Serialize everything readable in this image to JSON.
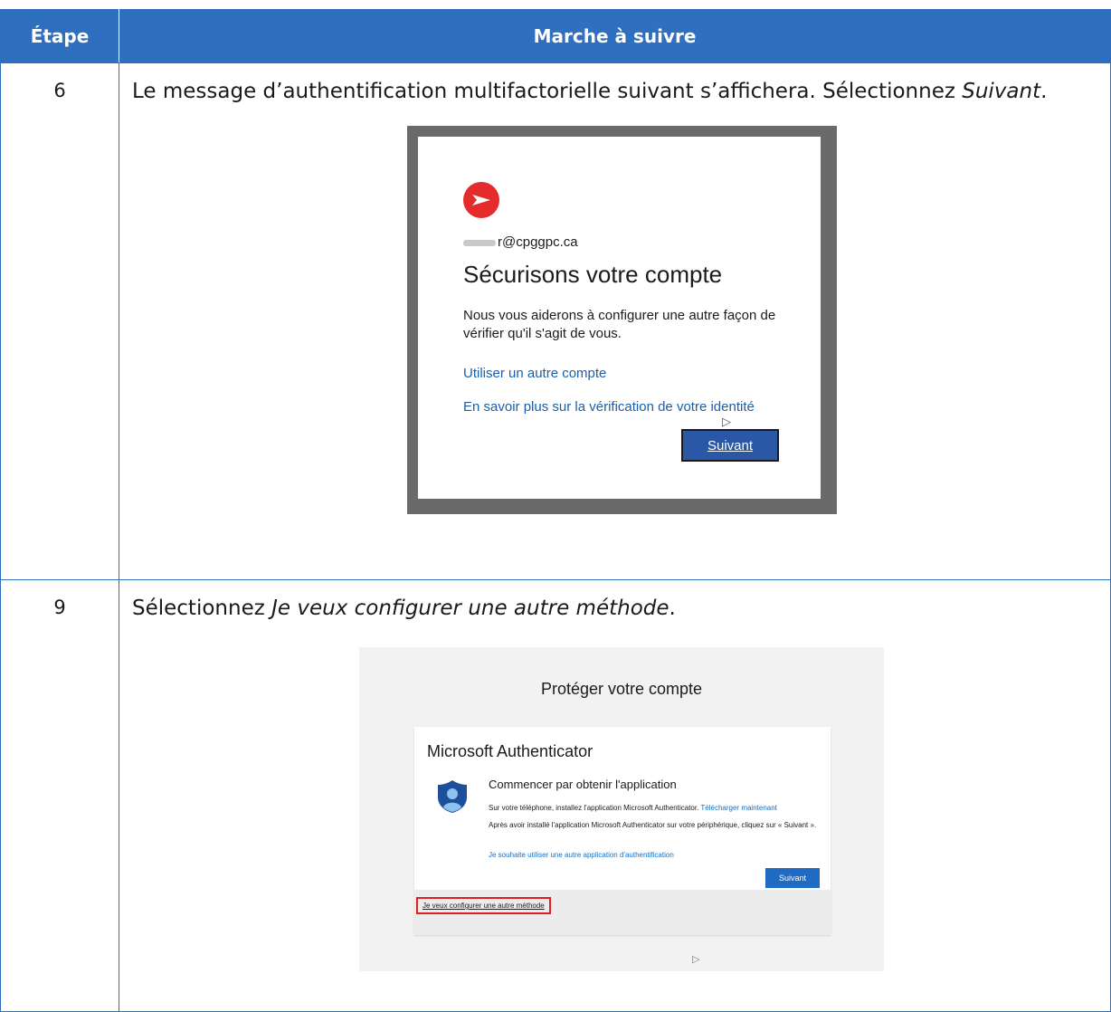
{
  "header": {
    "col_step": "Étape",
    "col_procedure": "Marche à suivre"
  },
  "rows": [
    {
      "step": "6",
      "instruction_text": "Le message d’authentification multifactorielle suivant s’affichera. Sélectionnez ",
      "instruction_emphasis": "Suivant",
      "instruction_end": ".",
      "screenshot": {
        "logo_icon": "canada-post-logo-icon",
        "email": "r@cpggpc.ca",
        "title": "Sécurisons votre compte",
        "description": "Nous vous aiderons à configurer une autre façon de vérifier qu'il s'agit de vous.",
        "link_other_account": "Utiliser un autre compte",
        "link_learn_more": "En savoir plus sur la vérification de votre identité",
        "next_button": "Suivant"
      }
    },
    {
      "step": "9",
      "instruction_text": "Sélectionnez ",
      "instruction_emphasis": "Je veux configurer une autre méthode",
      "instruction_end": ".",
      "screenshot": {
        "page_title": "Protéger votre compte",
        "card_heading": "Microsoft Authenticator",
        "app_icon": "microsoft-authenticator-icon",
        "subheading": "Commencer par obtenir l'application",
        "install_text": "Sur votre téléphone, installez l'application Microsoft Authenticator. ",
        "download_link": "Télécharger maintenant",
        "after_install_text": "Après avoir installé l'application Microsoft Authenticator sur votre périphérique, cliquez sur « Suivant ».",
        "other_app_link": "Je souhaite utiliser une autre application d'authentification",
        "next_button": "Suivant",
        "other_method_link": "Je veux configurer une autre méthode"
      }
    }
  ],
  "colors": {
    "header_bg": "#2f6fbf",
    "highlight_box": "#e02020",
    "link": "#1a5fa8"
  }
}
